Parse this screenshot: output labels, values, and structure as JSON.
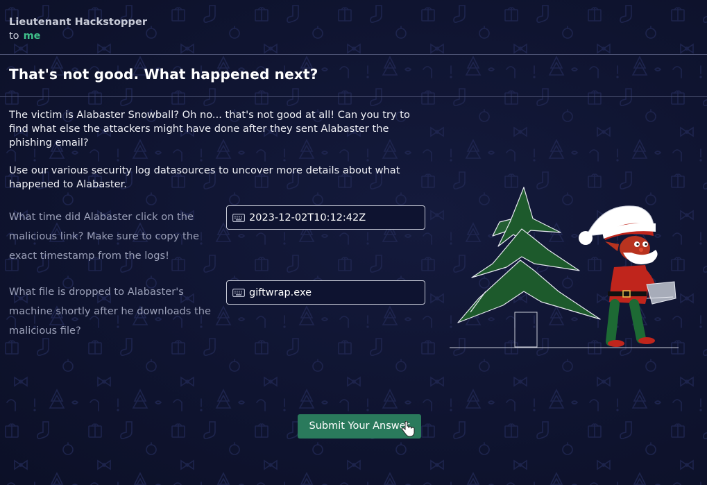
{
  "email": {
    "sender_name": "Lieutenant Hackstopper",
    "to_label": "to",
    "recipient": "me"
  },
  "message": {
    "title": "That's not good. What happened next?",
    "paragraph1": "The victim is Alabaster Snowball? Oh no... that's not good at all! Can you try to find what else the attackers might have done after they sent Alabaster the phishing email?",
    "paragraph2": "Use our various security log datasources to uncover more details about what happened to Alabaster."
  },
  "questions": [
    {
      "label": "What time did Alabaster click on the malicious link? Make sure to copy the exact timestamp from the logs!",
      "answer": "2023-12-02T10:12:42Z",
      "icon": "keyboard-icon"
    },
    {
      "label": "What file is dropped to Alabaster's machine shortly after he downloads the malicious file?",
      "answer": "giftwrap.exe",
      "icon": "keyboard-icon"
    }
  ],
  "submit": {
    "label": "Submit Your Answer"
  },
  "colors": {
    "background": "#0f1430",
    "accent_green": "#3fbf8a",
    "button_green": "#2a7a5c",
    "tree_green": "#1d5a2c",
    "santa_red": "#c0251c"
  }
}
